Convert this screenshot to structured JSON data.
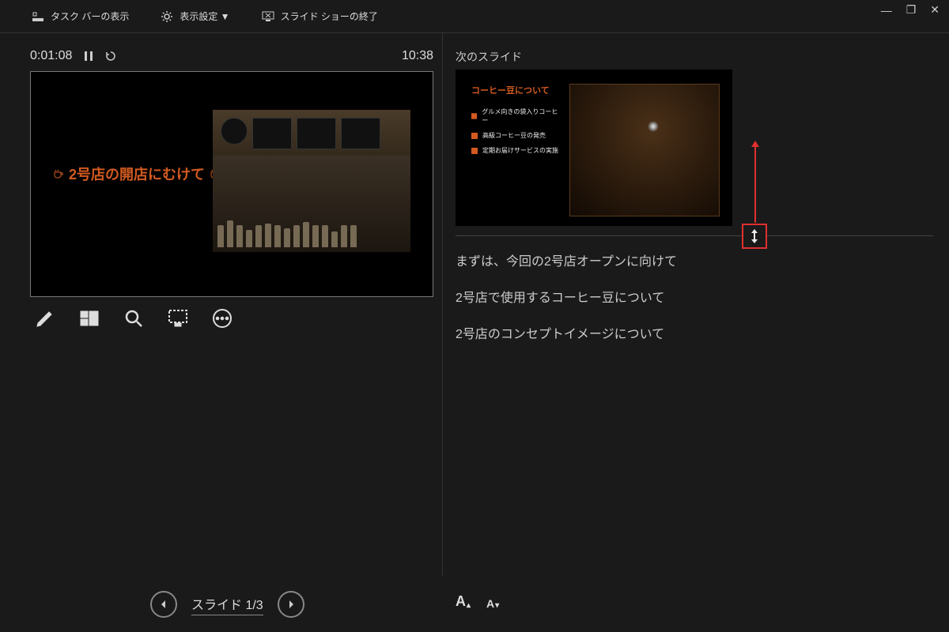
{
  "topbar": {
    "show_taskbar": "タスク バーの表示",
    "display_settings": "表示設定 ▼",
    "end_slideshow": "スライド ショーの終了"
  },
  "timer": {
    "elapsed": "0:01:08",
    "total": "10:38"
  },
  "current_slide": {
    "title": "2号店の開店にむけて"
  },
  "next": {
    "label": "次のスライド",
    "title": "コーヒー豆について",
    "bullets": [
      "グルメ向きの袋入りコーヒー",
      "高級コーヒー豆の発売",
      "定期お届けサービスの実施"
    ]
  },
  "notes": [
    "まずは、今回の2号店オープンに向けて",
    "2号店で使用するコーヒー豆について",
    "2号店のコンセプトイメージについて"
  ],
  "counter": {
    "label": "スライド 1/3"
  }
}
